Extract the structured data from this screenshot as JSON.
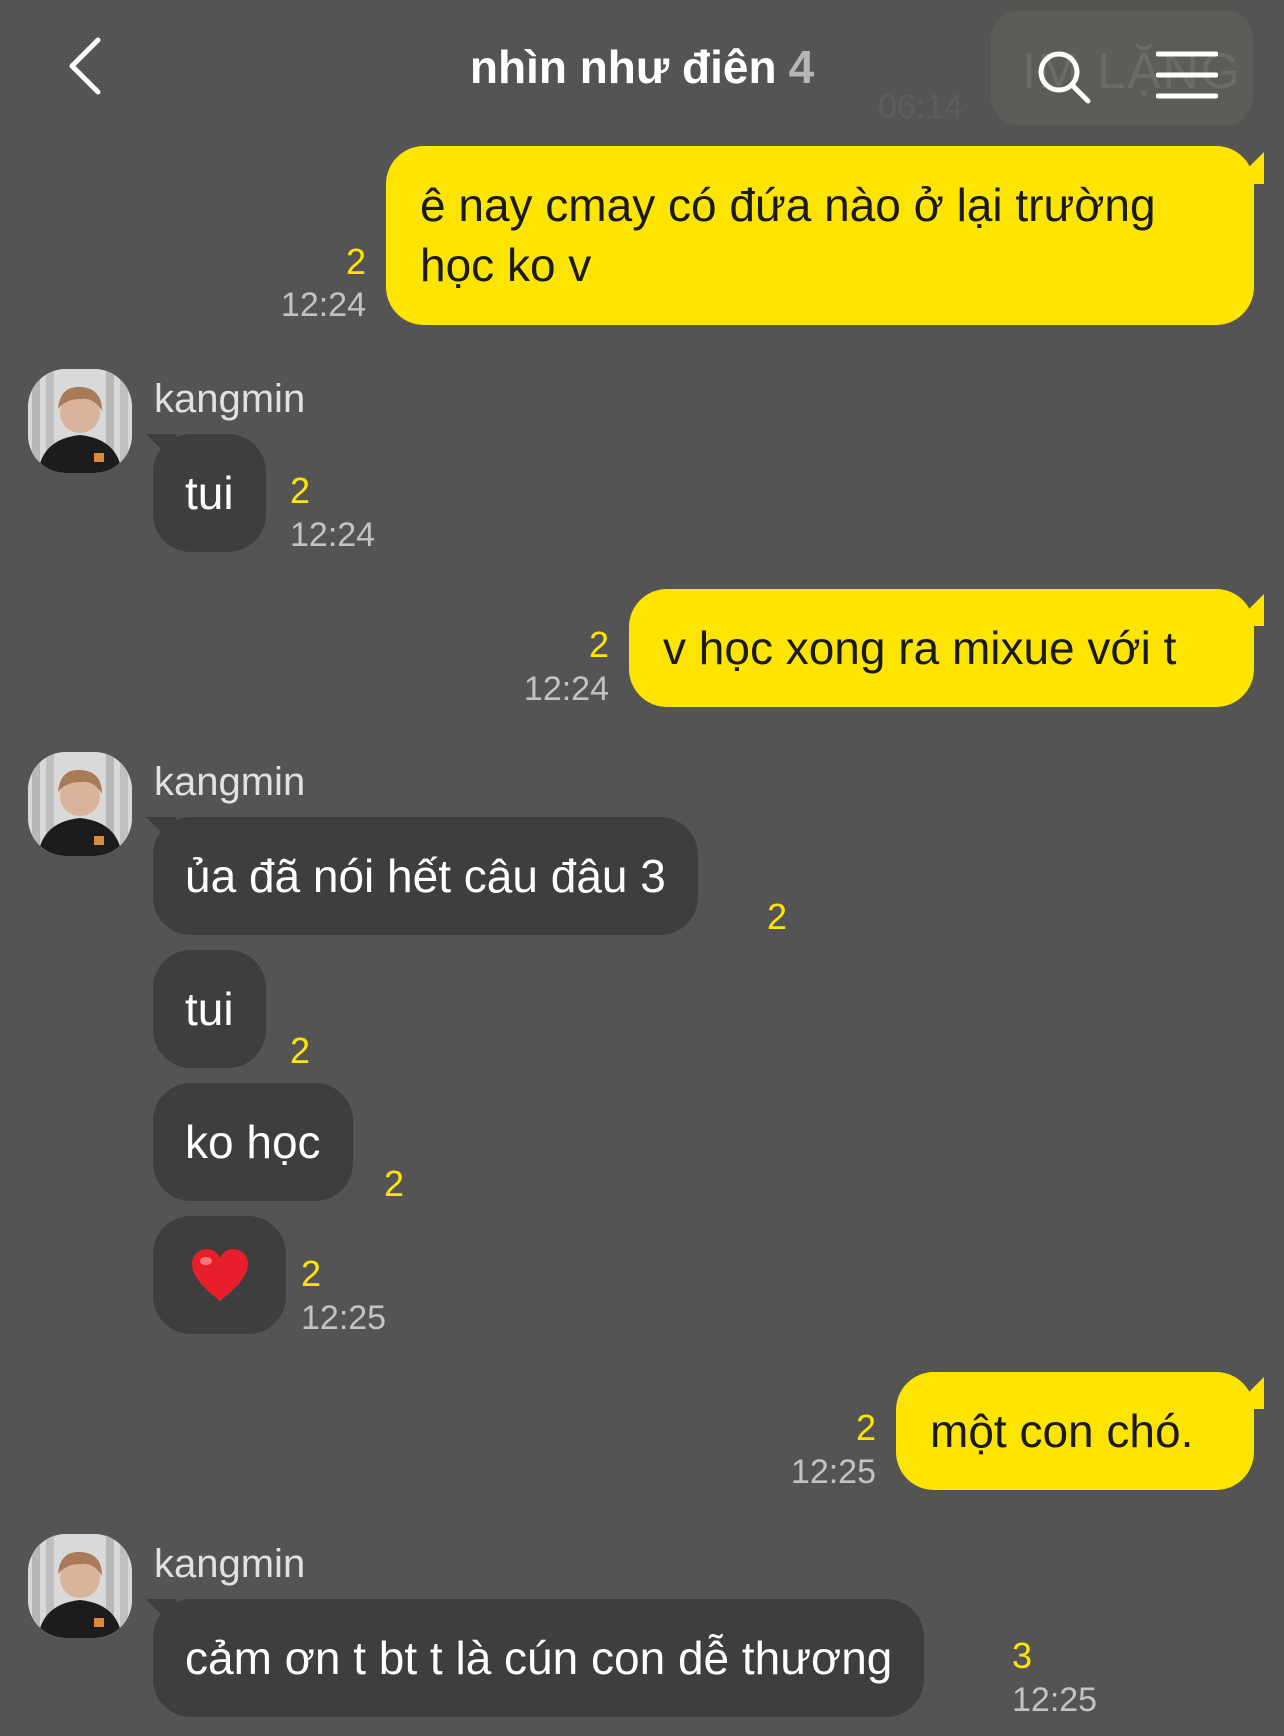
{
  "header": {
    "title": "nhìn như điên",
    "member_count": "4",
    "ghost_text": "IM LẶNG",
    "ghost_time": "06:14"
  },
  "messages": [
    {
      "side": "out",
      "lines": [
        "ê nay cmay có đứa nào ở lại trường",
        "học ko v"
      ],
      "unread": "2",
      "time": "12:24"
    },
    {
      "side": "in",
      "sender": "kangmin",
      "text": "tui",
      "unread": "2",
      "time": "12:24"
    },
    {
      "side": "out",
      "text": "v học xong ra mixue với t",
      "unread": "2",
      "time": "12:24"
    },
    {
      "side": "in",
      "sender": "kangmin",
      "text": "ủa đã nói hết câu đâu 3",
      "unread": "2"
    },
    {
      "side": "in",
      "text": "tui",
      "unread": "2"
    },
    {
      "side": "in",
      "text": "ko học",
      "unread": "2"
    },
    {
      "side": "in",
      "text": "❤️",
      "unread": "2",
      "time": "12:25"
    },
    {
      "side": "out",
      "text": "một con chó.",
      "unread": "2",
      "time": "12:25"
    },
    {
      "side": "in",
      "sender": "kangmin",
      "text": "cảm ơn t bt t là cún con dễ thương",
      "unread": "3",
      "time": "12:25"
    }
  ],
  "icons": {
    "back": "chevron-left-icon",
    "search": "search-icon",
    "menu": "hamburger-menu-icon",
    "heart": "red-heart-emoji"
  },
  "colors": {
    "background": "#555455",
    "outgoing_bubble": "#fee500",
    "incoming_bubble": "#3e3e3f",
    "unread_count": "#fee500",
    "timestamp": "#c4c3c4"
  }
}
